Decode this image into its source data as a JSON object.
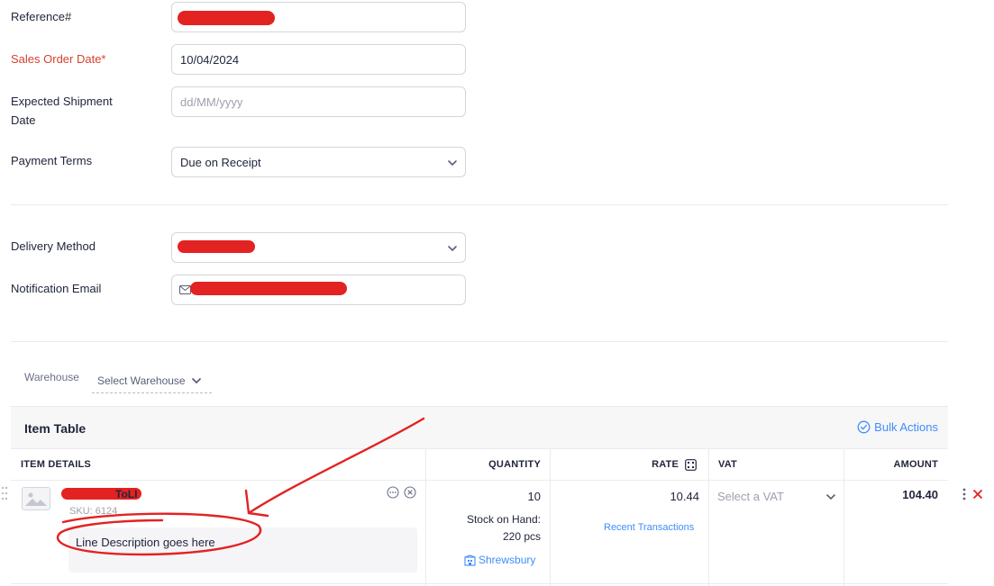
{
  "form": {
    "reference_label": "Reference#",
    "sales_order_date_label": "Sales Order Date*",
    "sales_order_date_value": "10/04/2024",
    "expected_shipment_label_line1": "Expected Shipment",
    "expected_shipment_label_line2": "Date",
    "expected_shipment_placeholder": "dd/MM/yyyy",
    "payment_terms_label": "Payment Terms",
    "payment_terms_value": "Due on Receipt",
    "delivery_method_label": "Delivery Method",
    "notification_email_label": "Notification Email"
  },
  "warehouse": {
    "label": "Warehouse",
    "select_placeholder": "Select Warehouse"
  },
  "item_table": {
    "title": "Item Table",
    "bulk_actions_label": "Bulk Actions",
    "columns": {
      "item_details": "ITEM DETAILS",
      "quantity": "QUANTITY",
      "rate": "RATE",
      "vat": "VAT",
      "amount": "AMOUNT"
    },
    "row": {
      "name_suffix": "ToLI",
      "sku": "SKU: 6124",
      "description": "Line Description goes here",
      "quantity": "10",
      "stock_label": "Stock on Hand:",
      "stock_value": "220 pcs",
      "warehouse": "Shrewsbury",
      "rate": "10.44",
      "recent_transactions": "Recent Transactions",
      "vat_placeholder": "Select a VAT",
      "amount": "104.40"
    }
  },
  "colors": {
    "accent": "#408dfb",
    "required": "#d6412f",
    "redaction": "#e32222",
    "delete": "#e32222"
  }
}
